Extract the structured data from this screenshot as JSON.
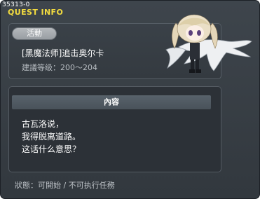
{
  "window": {
    "quest_id": "35313-0",
    "title": "QUEST INFO",
    "close_glyph": "×"
  },
  "header": {
    "category_badge": "活動",
    "quest_name": "[黑魔法师]追击奥尔卡",
    "level_requirement": "建議等级：200～204",
    "portrait_icon": "npc-portrait-girl-with-white-scarf"
  },
  "content": {
    "section_title": "內容",
    "dialogue_lines": [
      "古瓦洛说，",
      "我得脱离道路。",
      "这话什么意思？"
    ]
  },
  "footer": {
    "status": "狀態：可開始 / 不可执行任務"
  },
  "colors": {
    "title": "#f3dc3f",
    "window_bg": "#383e44",
    "panel_bg": "#2c3137",
    "badge_bg": "#a8acb0"
  }
}
